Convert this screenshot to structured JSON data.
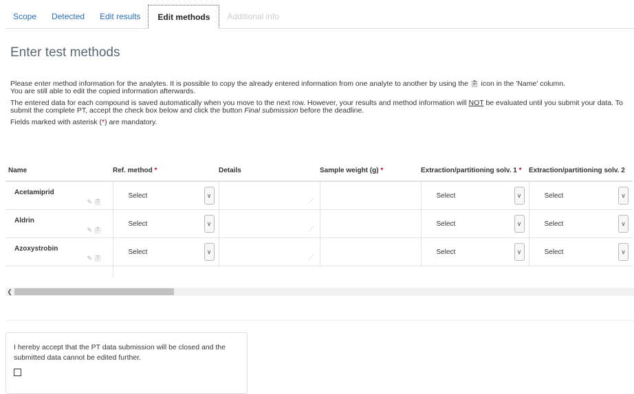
{
  "tabs": [
    {
      "label": "Scope",
      "state": "normal"
    },
    {
      "label": "Detected",
      "state": "normal"
    },
    {
      "label": "Edit results",
      "state": "normal"
    },
    {
      "label": "Edit methods",
      "state": "active"
    },
    {
      "label": "Additional info",
      "state": "disabled"
    }
  ],
  "page_title": "Enter test methods",
  "intro": {
    "p1_a": "Please enter method information for the analytes. It is possible to copy the already entered information from one analyte to another by using the",
    "p1_icon": "copy-icon",
    "p1_b": "icon in the 'Name' column.",
    "p2": "You are still able to edit the copied information afterwards.",
    "p3_a": "The entered data for each compound is saved automatically when you move to the next row. However, your results and method information will",
    "p3_not": "NOT",
    "p3_b": "be evaluated until you submit your data. To submit the complete PT, accept the check box below and click the button",
    "p3_em": "Final submission",
    "p3_c": "before the deadline.",
    "p4_a": "Fields marked with asterisk (",
    "p4_star": "*",
    "p4_b": ") are mandatory."
  },
  "table": {
    "headers": {
      "name": "Name",
      "ref_method": "Ref. method",
      "details": "Details",
      "sample_weight": "Sample weight (g)",
      "solv1": "Extraction/partitioning solv. 1",
      "solv2": "Extraction/partitioning solv. 2"
    },
    "required_mark": "*",
    "select_placeholder": "Select",
    "rows": [
      {
        "name": "Acetamiprid"
      },
      {
        "name": "Aldrin"
      },
      {
        "name": "Azoxystrobin"
      }
    ]
  },
  "accept": {
    "text": "I hereby accept that the PT data submission will be closed and the submitted data cannot be edited further."
  },
  "colors": {
    "link": "#2a6ebb",
    "required": "#d0021b",
    "title": "#5a6670"
  }
}
